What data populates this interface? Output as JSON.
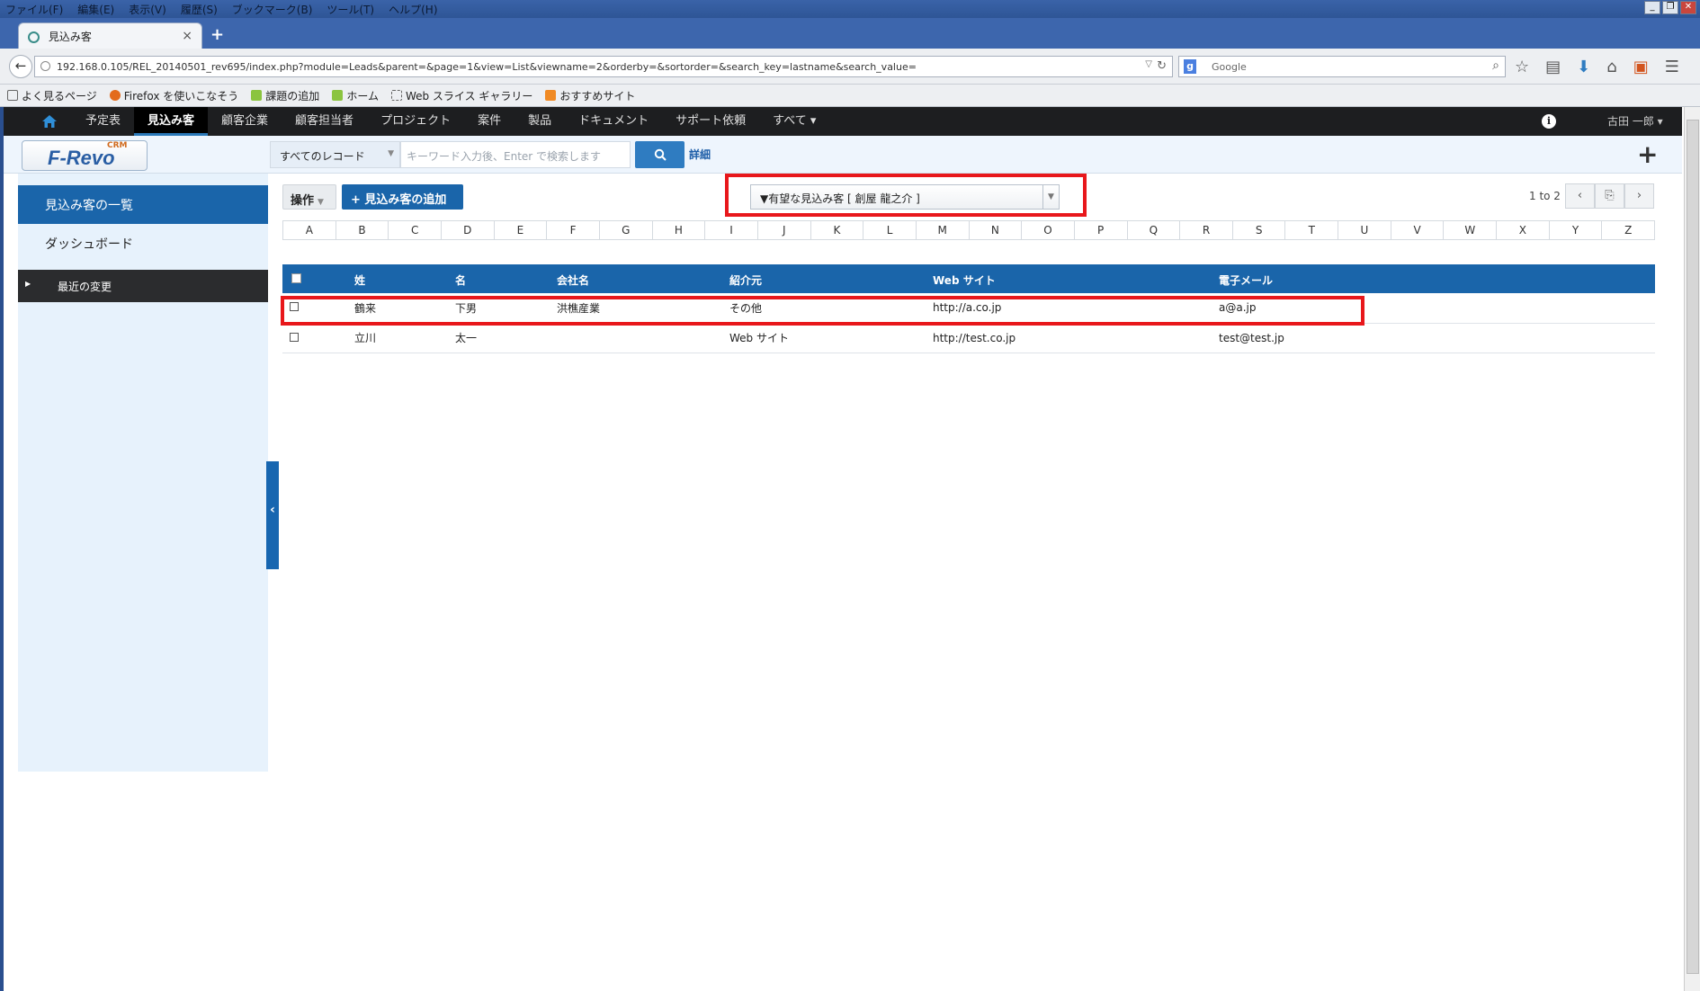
{
  "browser": {
    "menu": [
      "ファイル(F)",
      "編集(E)",
      "表示(V)",
      "履歴(S)",
      "ブックマーク(B)",
      "ツール(T)",
      "ヘルプ(H)"
    ],
    "tab_title": "見込み客",
    "url": "192.168.0.105/REL_20140501_rev695/index.php?module=Leads&parent=&page=1&view=List&viewname=2&orderby=&sortorder=&search_key=lastname&search_value=",
    "search_placeholder": "Google",
    "bookmarks": [
      "よく見るページ",
      "Firefox を使いこなそう",
      "課題の追加",
      "ホーム",
      "Web スライス ギャラリー",
      "おすすめサイト"
    ]
  },
  "topnav": {
    "items": [
      "予定表",
      "見込み客",
      "顧客企業",
      "顧客担当者",
      "プロジェクト",
      "案件",
      "製品",
      "ドキュメント",
      "サポート依頼",
      "すべて ▾"
    ],
    "active_index": 1,
    "user": "古田 一郎 ▾"
  },
  "subbar": {
    "logo": "F-Revo",
    "logo_badge": "CRM",
    "record_select": "すべてのレコード",
    "keyword_placeholder": "キーワード入力後、Enter で検索します",
    "detail_link": "詳細"
  },
  "sidebar": {
    "title": "見込み客の一覧",
    "dashboard": "ダッシュボード",
    "recent": "最近の変更"
  },
  "main": {
    "action_label": "操作",
    "add_label": "+ 見込み客の追加",
    "filter_value": "▼有望な見込み客 [ 創屋 龍之介 ]",
    "pager_text": "1 to 2",
    "alphabet": [
      "A",
      "B",
      "C",
      "D",
      "E",
      "F",
      "G",
      "H",
      "I",
      "J",
      "K",
      "L",
      "M",
      "N",
      "O",
      "P",
      "Q",
      "R",
      "S",
      "T",
      "U",
      "V",
      "W",
      "X",
      "Y",
      "Z"
    ],
    "columns": [
      "姓",
      "名",
      "会社名",
      "紹介元",
      "Web サイト",
      "電子メール"
    ],
    "rows": [
      {
        "last": "鶴来",
        "first": "下男",
        "company": "洪樵産業",
        "source": "その他",
        "website": "http://a.co.jp",
        "email": "a@a.jp"
      },
      {
        "last": "立川",
        "first": "太一",
        "company": "",
        "source": "Web サイト",
        "website": "http://test.co.jp",
        "email": "test@test.jp"
      }
    ]
  }
}
